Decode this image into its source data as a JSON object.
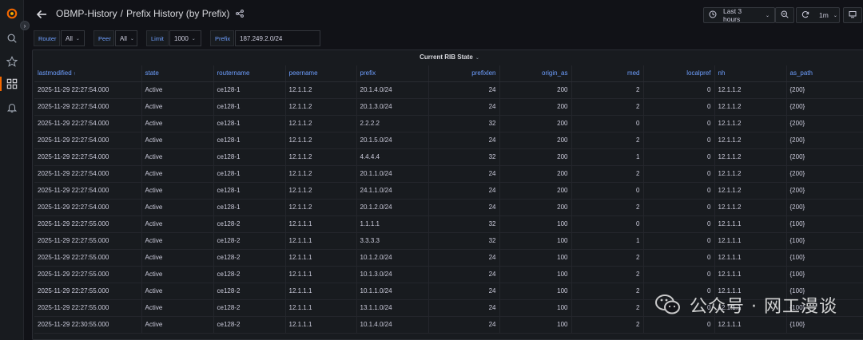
{
  "header": {
    "dashboard": "OBMP-History",
    "separator": "/",
    "page": "Prefix History (by Prefix)",
    "time_range": "Last 3 hours",
    "refresh_interval": "1m"
  },
  "variables": [
    {
      "label": "Router",
      "value": "All"
    },
    {
      "label": "Peer",
      "value": "All"
    },
    {
      "label": "Limit",
      "value": "1000"
    },
    {
      "label": "Prefix",
      "value": "187.249.2.0/24"
    }
  ],
  "panel": {
    "title": "Current RIB State",
    "columns": [
      "lastmodified",
      "state",
      "routername",
      "peername",
      "prefix",
      "prefixlen",
      "origin_as",
      "med",
      "localpref",
      "nh",
      "as_path"
    ],
    "rows": [
      [
        "2025-11-29 22:27:54.000",
        "Active",
        "ce128-1",
        "12.1.1.2",
        "20.1.4.0/24",
        "24",
        "200",
        "2",
        "0",
        "12.1.1.2",
        "{200}"
      ],
      [
        "2025-11-29 22:27:54.000",
        "Active",
        "ce128-1",
        "12.1.1.2",
        "20.1.3.0/24",
        "24",
        "200",
        "2",
        "0",
        "12.1.1.2",
        "{200}"
      ],
      [
        "2025-11-29 22:27:54.000",
        "Active",
        "ce128-1",
        "12.1.1.2",
        "2.2.2.2",
        "32",
        "200",
        "0",
        "0",
        "12.1.1.2",
        "{200}"
      ],
      [
        "2025-11-29 22:27:54.000",
        "Active",
        "ce128-1",
        "12.1.1.2",
        "20.1.5.0/24",
        "24",
        "200",
        "2",
        "0",
        "12.1.1.2",
        "{200}"
      ],
      [
        "2025-11-29 22:27:54.000",
        "Active",
        "ce128-1",
        "12.1.1.2",
        "4.4.4.4",
        "32",
        "200",
        "1",
        "0",
        "12.1.1.2",
        "{200}"
      ],
      [
        "2025-11-29 22:27:54.000",
        "Active",
        "ce128-1",
        "12.1.1.2",
        "20.1.1.0/24",
        "24",
        "200",
        "2",
        "0",
        "12.1.1.2",
        "{200}"
      ],
      [
        "2025-11-29 22:27:54.000",
        "Active",
        "ce128-1",
        "12.1.1.2",
        "24.1.1.0/24",
        "24",
        "200",
        "0",
        "0",
        "12.1.1.2",
        "{200}"
      ],
      [
        "2025-11-29 22:27:54.000",
        "Active",
        "ce128-1",
        "12.1.1.2",
        "20.1.2.0/24",
        "24",
        "200",
        "2",
        "0",
        "12.1.1.2",
        "{200}"
      ],
      [
        "2025-11-29 22:27:55.000",
        "Active",
        "ce128-2",
        "12.1.1.1",
        "1.1.1.1",
        "32",
        "100",
        "0",
        "0",
        "12.1.1.1",
        "{100}"
      ],
      [
        "2025-11-29 22:27:55.000",
        "Active",
        "ce128-2",
        "12.1.1.1",
        "3.3.3.3",
        "32",
        "100",
        "1",
        "0",
        "12.1.1.1",
        "{100}"
      ],
      [
        "2025-11-29 22:27:55.000",
        "Active",
        "ce128-2",
        "12.1.1.1",
        "10.1.2.0/24",
        "24",
        "100",
        "2",
        "0",
        "12.1.1.1",
        "{100}"
      ],
      [
        "2025-11-29 22:27:55.000",
        "Active",
        "ce128-2",
        "12.1.1.1",
        "10.1.3.0/24",
        "24",
        "100",
        "2",
        "0",
        "12.1.1.1",
        "{100}"
      ],
      [
        "2025-11-29 22:27:55.000",
        "Active",
        "ce128-2",
        "12.1.1.1",
        "10.1.1.0/24",
        "24",
        "100",
        "2",
        "0",
        "12.1.1.1",
        "{100}"
      ],
      [
        "2025-11-29 22:27:55.000",
        "Active",
        "ce128-2",
        "12.1.1.1",
        "13.1.1.0/24",
        "24",
        "100",
        "2",
        "0",
        "12.1.1.1",
        "{100}"
      ],
      [
        "2025-11-29 22:30:55.000",
        "Active",
        "ce128-2",
        "12.1.1.1",
        "10.1.4.0/24",
        "24",
        "100",
        "2",
        "0",
        "12.1.1.1",
        "{100}"
      ]
    ]
  },
  "watermark": {
    "text": "公众号 · 网工漫谈",
    "icon": "wechat-icon"
  },
  "icons": {
    "sidebar": [
      "grafana-logo-icon",
      "search-icon",
      "star-icon",
      "dashboards-icon",
      "bell-icon"
    ],
    "header": [
      "back-arrow-icon",
      "share-icon",
      "clock-icon",
      "zoom-out-icon",
      "refresh-icon",
      "tv-mode-icon"
    ]
  },
  "colors": {
    "accent": "#6e9fff",
    "background": "#111217",
    "panel": "#181b1f",
    "logo": "#f46800"
  }
}
